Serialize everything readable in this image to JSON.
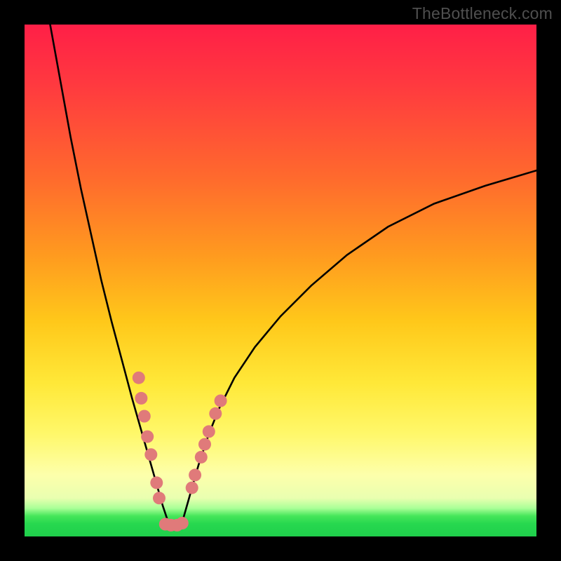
{
  "watermark": "TheBottleneck.com",
  "colors": {
    "frame": "#000000",
    "curve": "#000000",
    "marker_fill": "#e07a7a",
    "marker_stroke": "#c65555",
    "gradient_top": "#ff1f47",
    "gradient_bottom": "#1fcf4b"
  },
  "chart_data": {
    "type": "line",
    "title": "",
    "xlabel": "",
    "ylabel": "",
    "xlim": [
      0,
      100
    ],
    "ylim": [
      0,
      100
    ],
    "grid": false,
    "series": [
      {
        "name": "bottleneck-curve",
        "x": [
          5.0,
          7.0,
          9.0,
          11.0,
          13.0,
          15.0,
          17.0,
          19.0,
          21.0,
          23.0,
          24.0,
          25.0,
          26.0,
          27.0,
          28.0,
          29.0,
          30.0,
          31.0,
          32.0,
          34.0,
          36.0,
          38.0,
          41.0,
          45.0,
          50.0,
          56.0,
          63.0,
          71.0,
          80.0,
          90.0,
          100.0
        ],
        "values": [
          100,
          89.0,
          78.0,
          68.0,
          59.0,
          50.0,
          42.0,
          34.5,
          27.0,
          20.0,
          16.5,
          13.0,
          9.5,
          6.0,
          3.0,
          2.2,
          2.2,
          3.5,
          7.0,
          14.0,
          20.0,
          25.0,
          31.0,
          37.0,
          43.0,
          49.0,
          55.0,
          60.5,
          65.0,
          68.5,
          71.5
        ]
      }
    ],
    "markers_left": [
      {
        "x": 22.3,
        "y": 31.0
      },
      {
        "x": 22.8,
        "y": 27.0
      },
      {
        "x": 23.4,
        "y": 23.5
      },
      {
        "x": 24.0,
        "y": 19.5
      },
      {
        "x": 24.7,
        "y": 16.0
      },
      {
        "x": 25.8,
        "y": 10.5
      },
      {
        "x": 26.3,
        "y": 7.5
      }
    ],
    "markers_right": [
      {
        "x": 32.7,
        "y": 9.5
      },
      {
        "x": 33.3,
        "y": 12.0
      },
      {
        "x": 34.5,
        "y": 15.5
      },
      {
        "x": 35.2,
        "y": 18.0
      },
      {
        "x": 36.0,
        "y": 20.5
      },
      {
        "x": 37.3,
        "y": 24.0
      },
      {
        "x": 38.3,
        "y": 26.5
      }
    ],
    "markers_bottom": [
      {
        "x": 27.5,
        "y": 2.4
      },
      {
        "x": 28.6,
        "y": 2.2
      },
      {
        "x": 29.8,
        "y": 2.2
      },
      {
        "x": 30.8,
        "y": 2.6
      }
    ]
  }
}
